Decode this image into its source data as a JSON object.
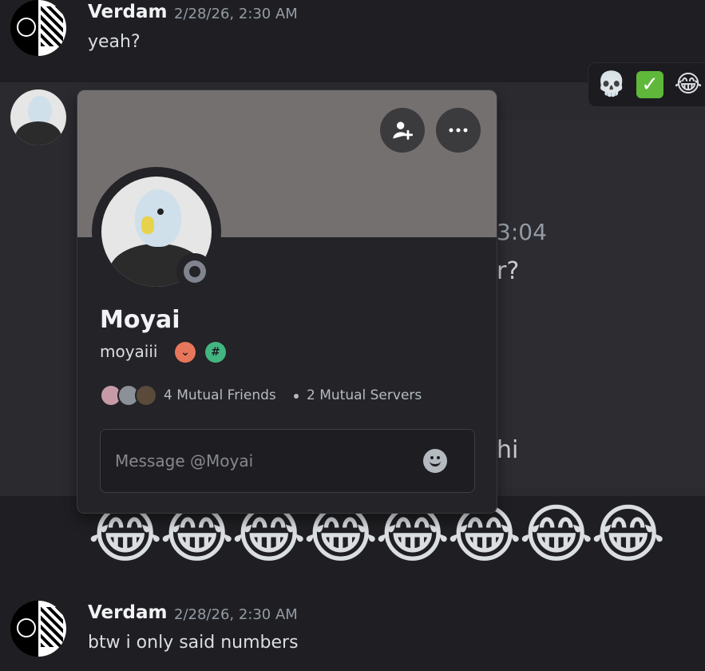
{
  "messages": {
    "top": {
      "author": "Verdam",
      "time": "2/28/26, 2:30 AM",
      "text": "yeah?"
    },
    "bottom": {
      "author": "Verdam",
      "time": "2/28/26, 2:30 AM",
      "text": "btw i only said numbers"
    }
  },
  "partial_visible": {
    "time_fragment": "3:04",
    "text_fragment_1": "r?",
    "text_fragment_2": "hi"
  },
  "reactions_bar": {
    "items": [
      {
        "icon": "skull-icon",
        "glyph": "💀"
      },
      {
        "icon": "check-mark-icon",
        "glyph": "✓"
      },
      {
        "icon": "joy-icon",
        "glyph": "😂"
      }
    ]
  },
  "emoji_row": {
    "glyph": "😂",
    "count": 8
  },
  "profile": {
    "display_name": "Moyai",
    "username": "moyaiii",
    "badges": [
      {
        "icon": "chevron-badge-icon",
        "glyph": "⌄",
        "color": "#e8765a"
      },
      {
        "icon": "hash-badge-icon",
        "glyph": "#",
        "color": "#43b581"
      }
    ],
    "mutual_friends": "4 Mutual Friends",
    "mutual_servers": "2 Mutual Servers",
    "message_placeholder": "Message @Moyai",
    "banner_color": "#757070",
    "status": "offline"
  },
  "colors": {
    "background": "#1f1f23",
    "popout": "#232328"
  }
}
